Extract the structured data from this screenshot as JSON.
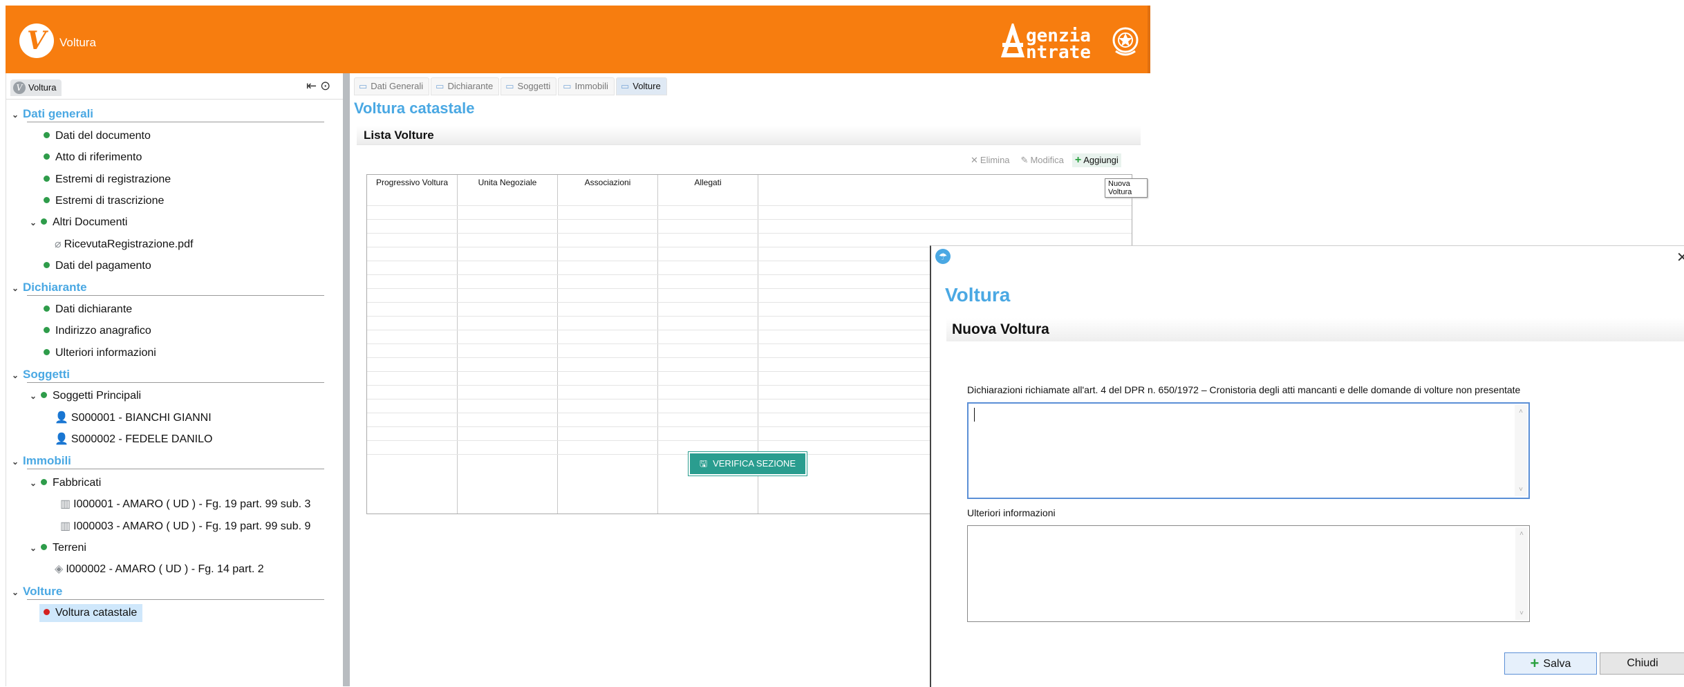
{
  "app": {
    "logo_letter": "V",
    "name": "Voltura",
    "agency_line1": "genzia",
    "agency_line2": "ntrate",
    "brand_color": "#f77d0f",
    "accent_color": "#4aa8e3"
  },
  "sidebar": {
    "tab_label": "Voltura",
    "sections": [
      {
        "title": "Dati generali",
        "items": [
          "Dati del documento",
          "Atto di riferimento",
          "Estremi di registrazione",
          "Estremi di trascrizione",
          "Altri Documenti",
          "RicevutaRegistrazione.pdf",
          "Dati del pagamento"
        ]
      },
      {
        "title": "Dichiarante",
        "items": [
          "Dati dichiarante",
          "Indirizzo anagrafico",
          "Ulteriori informazioni"
        ]
      },
      {
        "title": "Soggetti",
        "items": [
          "Soggetti Principali",
          "S000001 - BIANCHI GIANNI",
          "S000002 - FEDELE DANILO"
        ]
      },
      {
        "title": "Immobili",
        "items": [
          "Fabbricati",
          "I000001 - AMARO ( UD ) - Fg. 19 part. 99 sub. 3",
          "I000003 - AMARO ( UD ) - Fg. 19 part. 99 sub. 9",
          "Terreni",
          "I000002 - AMARO ( UD ) - Fg. 14 part. 2"
        ]
      },
      {
        "title": "Volture",
        "items": [
          "Voltura catastale"
        ]
      }
    ]
  },
  "content": {
    "tabs": [
      "Dati Generali",
      "Dichiarante",
      "Soggetti",
      "Immobili",
      "Volture"
    ],
    "active_tab": "Volture",
    "title": "Voltura catastale",
    "section_title": "Lista  Volture",
    "toolbar": {
      "delete": "Elimina",
      "edit": "Modifica",
      "add": "Aggiungi"
    },
    "tooltip": "Nuova Voltura",
    "grid_columns": [
      "Progressivo Voltura",
      "Unita Negoziale",
      "Associazioni",
      "Allegati"
    ],
    "verify_button": "VERIFICA SEZIONE"
  },
  "dialog": {
    "title": "Voltura",
    "subtitle": "Nuova Voltura",
    "field1_label": "Dichiarazioni richiamate all'art. 4 del DPR n. 650/1972 – Cronistoria degli atti mancanti e delle domande di volture non presentate",
    "field1_value": "",
    "field2_label": "Ulteriori informazioni",
    "field2_value": "",
    "save_label": "Salva",
    "close_label": "Chiudi"
  }
}
